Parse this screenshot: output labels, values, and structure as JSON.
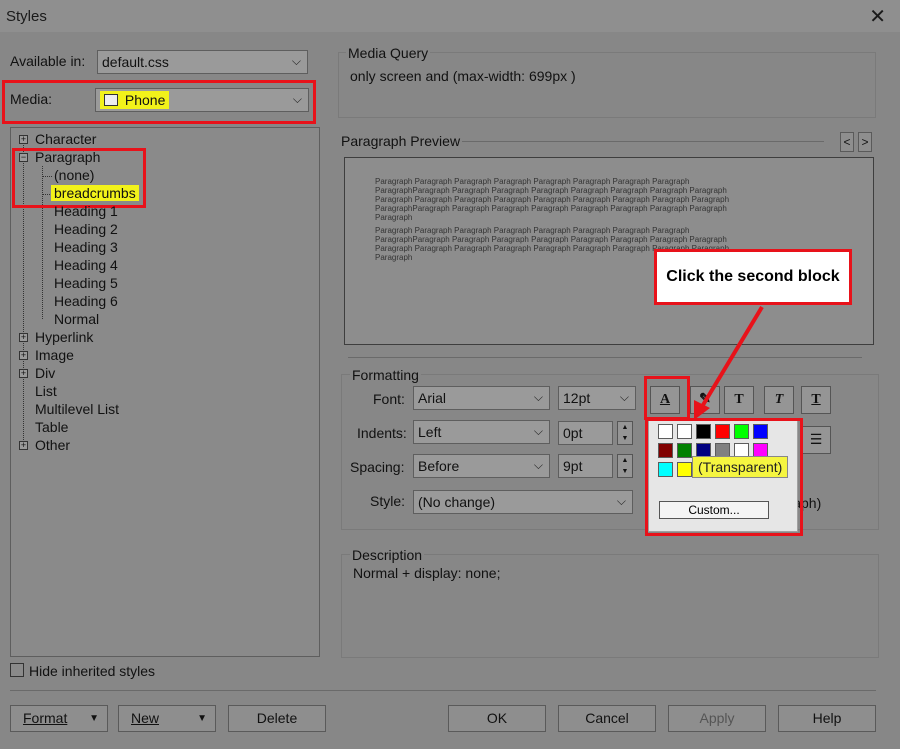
{
  "window": {
    "title": "Styles",
    "close_glyph": "✕"
  },
  "available_in": {
    "label": "Available in:",
    "value": "default.css"
  },
  "media": {
    "label": "Media:",
    "value": "Phone",
    "icon": "phone-device-icon"
  },
  "media_query": {
    "label": "Media Query",
    "value": "only screen and (max-width: 699px )"
  },
  "tree": {
    "items": [
      {
        "label": "Character",
        "expandable": true,
        "expanded": false
      },
      {
        "label": "Paragraph",
        "expandable": true,
        "expanded": true
      },
      {
        "label": "(none)"
      },
      {
        "label": "breadcrumbs",
        "selected": true
      },
      {
        "label": "Heading 1"
      },
      {
        "label": "Heading 2"
      },
      {
        "label": "Heading 3"
      },
      {
        "label": "Heading 4"
      },
      {
        "label": "Heading 5"
      },
      {
        "label": "Heading 6"
      },
      {
        "label": "Normal"
      },
      {
        "label": "Hyperlink",
        "expandable": true
      },
      {
        "label": "Image",
        "expandable": true
      },
      {
        "label": "Div",
        "expandable": true
      },
      {
        "label": "List"
      },
      {
        "label": "Multilevel List"
      },
      {
        "label": "Table"
      },
      {
        "label": "Other",
        "expandable": true
      }
    ]
  },
  "preview": {
    "label": "Paragraph Preview",
    "prev_glyph": "<",
    "next_glyph": ">",
    "lines": [
      "Paragraph Paragraph Paragraph Paragraph Paragraph Paragraph Paragraph Paragraph",
      "ParagraphParagraph Paragraph Paragraph Paragraph Paragraph Paragraph Paragraph Paragraph",
      "Paragraph Paragraph Paragraph Paragraph Paragraph Paragraph Paragraph Paragraph Paragraph",
      "ParagraphParagraph Paragraph Paragraph Paragraph Paragraph Paragraph Paragraph Paragraph",
      "Paragraph",
      "Paragraph Paragraph Paragraph Paragraph Paragraph Paragraph Paragraph Paragraph",
      "ParagraphParagraph Paragraph Paragraph Paragraph Paragraph Paragraph Paragraph Paragraph",
      "Paragraph Paragraph Paragraph Paragraph Paragraph Paragraph Paragraph Paragraph Paragraph",
      "Paragraph"
    ]
  },
  "formatting": {
    "label": "Formatting",
    "font_label": "Font:",
    "font_value": "Arial",
    "size_value": "12pt",
    "indents_label": "Indents:",
    "indents_value": "Left",
    "indents_size": "0pt",
    "spacing_label": "Spacing:",
    "spacing_value": "Before",
    "spacing_size": "9pt",
    "style_label": "Style:",
    "style_value": "(No change)",
    "obscured_tail_start": "(",
    "obscured_tail": "agraph)",
    "tool_glyphs": {
      "font_color": "A",
      "bold": "T",
      "italic": "T",
      "underline": "T"
    }
  },
  "color_picker": {
    "tooltip": "(Transparent)",
    "custom_label": "Custom...",
    "swatches": [
      "#ffffff",
      "#ffffff",
      "#000000",
      "#ff0000",
      "#00ff00",
      "#0000ff",
      "#800000",
      "#008000",
      "#000080",
      "#808080",
      "#ffffff",
      "#ff00ff",
      "#00ffff",
      "#ffff00",
      "#c0c0c0",
      "#c8d0d8"
    ]
  },
  "callout": {
    "text": "Click the second block"
  },
  "description": {
    "label": "Description",
    "value": "Normal +  display: none;"
  },
  "hide_inherited": {
    "label": "Hide inherited styles",
    "checked": false
  },
  "buttons": {
    "format": "Format",
    "new": "New",
    "delete": "Delete",
    "ok": "OK",
    "cancel": "Cancel",
    "apply": "Apply",
    "help": "Help"
  },
  "colors": {
    "highlight": "#f2f21a",
    "annotation_red": "#e8121a"
  }
}
